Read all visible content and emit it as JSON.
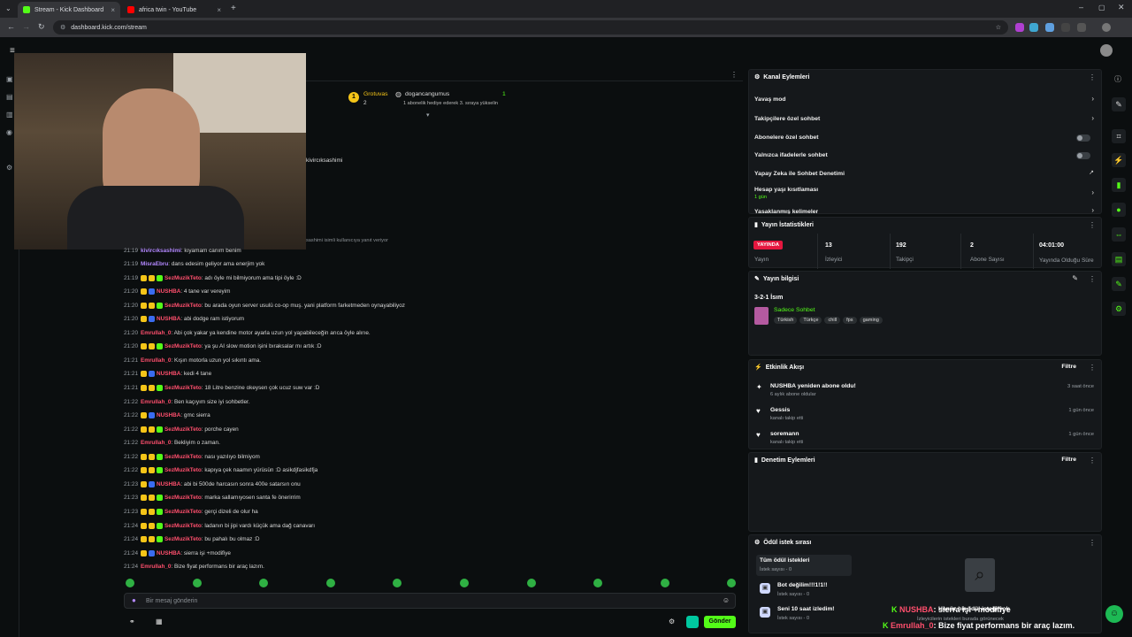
{
  "browser": {
    "tabs": [
      {
        "label": "Stream - Kick Dashboard",
        "active": true,
        "favicon_color": "#53fc18"
      },
      {
        "label": "africa twin - YouTube",
        "active": false,
        "favicon_color": "#ff0000"
      }
    ],
    "url": "dashboard.kick.com/stream"
  },
  "chat": {
    "title_user": "kivircıksashimi",
    "reply_hint": "sashimi isimli kullanıcıya yanıt veriyor",
    "gift_banner": {
      "rank": "1",
      "user1": "Grotuvas",
      "user1_count": "2",
      "user2": "dogancangumus",
      "user2_count": "1",
      "subtitle": "1 abonelik hediye ederek 3. sıraya yükselin"
    },
    "messages": [
      {
        "time": "21:19",
        "user": "kivircıksashimi",
        "color": "#b388ff",
        "text": ": kıyamam canım benim",
        "badges": 0
      },
      {
        "time": "21:19",
        "user": "MisraEbru",
        "color": "#b388ff",
        "text": ": dans edesim geliyor ama enerjim yok",
        "badges": 0
      },
      {
        "time": "21:19",
        "user": "SezMuzikTeto",
        "color": "#ff4f6d",
        "text": ": adı öyle mi bilmiyorum ama tipi öyle :D",
        "badges": 3
      },
      {
        "time": "21:20",
        "user": "NUSHBA",
        "color": "#ff4f6d",
        "text": ": 4 tane var vereyim",
        "badges": 2
      },
      {
        "time": "21:20",
        "user": "SezMuzikTeto",
        "color": "#ff4f6d",
        "text": ": bu arada oyun server usulü co-op muş. yani platform farketmeden oynayabiliyoz",
        "badges": 3
      },
      {
        "time": "21:20",
        "user": "NUSHBA",
        "color": "#ff4f6d",
        "text": ": abi dodge ram istiyorum",
        "badges": 2
      },
      {
        "time": "21:20",
        "user": "Emrullah_0",
        "color": "#ff4f6d",
        "text": ": Abi çok yakar ya kendine motor ayarla uzun yol yapabileceğin arıca öyle alırıe.",
        "badges": 0
      },
      {
        "time": "21:20",
        "user": "SezMuzikTeto",
        "color": "#ff4f6d",
        "text": ": ya şu AI slow motion işini bıraksalar mı artık :D",
        "badges": 3
      },
      {
        "time": "21:21",
        "user": "Emrullah_0",
        "color": "#ff4f6d",
        "text": ": Kışın motorla uzun yol sıkıntı ama.",
        "badges": 0
      },
      {
        "time": "21:21",
        "user": "NUSHBA",
        "color": "#ff4f6d",
        "text": ": kedi 4 tane",
        "badges": 2
      },
      {
        "time": "21:21",
        "user": "SezMuzikTeto",
        "color": "#ff4f6d",
        "text": ": 18 Litre benzine okeysen çok ucuz suw var :D",
        "badges": 3
      },
      {
        "time": "21:22",
        "user": "Emrullah_0",
        "color": "#ff4f6d",
        "text": ": Ben kaçıyım size iyi sohbetler.",
        "badges": 0
      },
      {
        "time": "21:22",
        "user": "NUSHBA",
        "color": "#ff4f6d",
        "text": ": gmc sierra",
        "badges": 2
      },
      {
        "time": "21:22",
        "user": "SezMuzikTeto",
        "color": "#ff4f6d",
        "text": ": porche cayen",
        "badges": 3
      },
      {
        "time": "21:22",
        "user": "Emrullah_0",
        "color": "#ff4f6d",
        "text": ": Bekliyim o zaman.",
        "badges": 0
      },
      {
        "time": "21:22",
        "user": "SezMuzikTeto",
        "color": "#ff4f6d",
        "text": ": nası yazılıyo bilmiyom",
        "badges": 3
      },
      {
        "time": "21:22",
        "user": "SezMuzikTeto",
        "color": "#ff4f6d",
        "text": ": kapıya çek naamın yürüsün :D asikdjfasikdfja",
        "badges": 3
      },
      {
        "time": "21:23",
        "user": "NUSHBA",
        "color": "#ff4f6d",
        "text": ": abi bi 500de harcasın sonra 400e satarsın onu",
        "badges": 2
      },
      {
        "time": "21:23",
        "user": "SezMuzikTeto",
        "color": "#ff4f6d",
        "text": ": marka sallamıyosen santa fe önerirrim",
        "badges": 3
      },
      {
        "time": "21:23",
        "user": "SezMuzikTeto",
        "color": "#ff4f6d",
        "text": ": gerçi dizeli de olur ha",
        "badges": 3
      },
      {
        "time": "21:24",
        "user": "SezMuzikTeto",
        "color": "#ff4f6d",
        "text": ": ladanın bi jipi vardı küçük ama dağ canavarı",
        "badges": 3
      },
      {
        "time": "21:24",
        "user": "SezMuzikTeto",
        "color": "#ff4f6d",
        "text": ": bu pahalı bu olmaz :D",
        "badges": 3
      },
      {
        "time": "21:24",
        "user": "NUSHBA",
        "color": "#ff4f6d",
        "text": ": sierra işi +modifiye",
        "badges": 2
      },
      {
        "time": "21:24",
        "user": "Emrullah_0",
        "color": "#ff4f6d",
        "text": ": Bize fiyat performans bir araç lazım.",
        "badges": 0
      }
    ],
    "input_placeholder": "Bir mesaj gönderin",
    "send_label": "Gönder"
  },
  "channel_actions": {
    "title": "Kanal Eylemleri",
    "rows": [
      {
        "label": "Yavaş mod",
        "type": "chevron"
      },
      {
        "label": "Takipçilere özel sohbet",
        "type": "chevron"
      },
      {
        "label": "Abonelere özel sohbet",
        "type": "toggle"
      },
      {
        "label": "Yalnızca ifadelerle sohbet",
        "type": "toggle"
      },
      {
        "label": "Yapay Zeka ile Sohbet Denetimi",
        "type": "external"
      },
      {
        "label": "Hesap yaşı kısıtlaması",
        "type": "chevron",
        "sub": "1 gün"
      },
      {
        "label": "Yasaklanmış kelimeler",
        "type": "chevron"
      }
    ]
  },
  "stream_stats": {
    "title": "Yayın İstatistikleri",
    "live_badge": "YAYINDA",
    "stats": [
      {
        "value": "",
        "label": "Yayın"
      },
      {
        "value": "13",
        "label": "İzleyici"
      },
      {
        "value": "192",
        "label": "Takipçi"
      },
      {
        "value": "2",
        "label": "Abone Sayısı"
      },
      {
        "value": "04:01:00",
        "label": "Yayında Olduğu Süre"
      }
    ]
  },
  "stream_info": {
    "title": "Yayın bilgisi",
    "stream_title": "3-2-1 İsım",
    "category": "Sadece Sohbet",
    "tags": [
      "Türkish",
      "Türkçe",
      "chill",
      "fps",
      "gaming"
    ]
  },
  "activity": {
    "title": "Etkinlik Akışı",
    "filter": "Filtre",
    "events": [
      {
        "title": "NUSHBA yeniden abone oldu!",
        "sub": "6 aylık abone oldular",
        "time": "3 saat önce",
        "icon": "star-icon"
      },
      {
        "title": "Gessis",
        "sub": "kanalı takip etti",
        "time": "1 gün önce",
        "icon": "heart-icon"
      },
      {
        "title": "soremann",
        "sub": "kanalı takip etti",
        "time": "1 gün önce",
        "icon": "heart-icon"
      }
    ]
  },
  "moderation": {
    "title": "Denetim Eylemleri",
    "filter": "Filtre"
  },
  "rewards": {
    "title": "Ödül istek sırası",
    "items": [
      {
        "title": "Tüm ödül istekleri",
        "sub": "İstek sayısı - 0"
      },
      {
        "title": "Bot değilim!!!1!1!!",
        "sub": "İstek sayısı - 0"
      },
      {
        "title": "Seni 10 saat izledim!",
        "sub": "İstek sayısı - 0"
      }
    ],
    "empty_title": "Henüz bir ödül isteği yok",
    "empty_sub": "İzleyicilerin istekleri burada görünecek"
  },
  "overlay": {
    "line1_user": "NUSHBA",
    "line1_text": ": sierra işi +modifiye",
    "line2_user": "Emrullah_0",
    "line2_text": ": Bize fiyat performans bir araç lazım."
  }
}
